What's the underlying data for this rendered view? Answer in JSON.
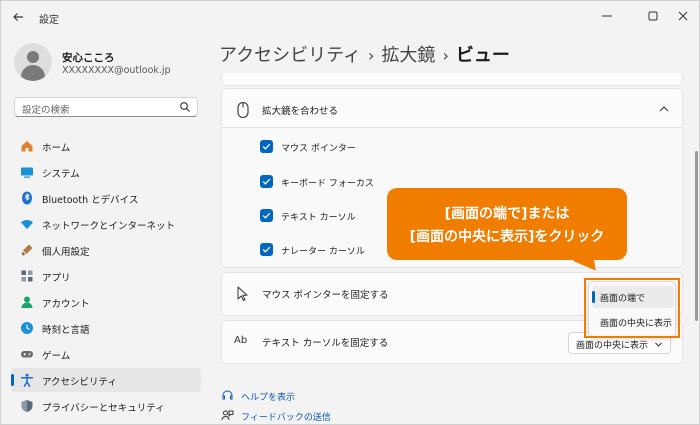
{
  "window": {
    "title": "設定",
    "controls": [
      "minimize-icon",
      "maximize-icon",
      "close-icon"
    ]
  },
  "profile": {
    "name": "安心こころ",
    "email": "XXXXXXXX@outlook.jp"
  },
  "search": {
    "placeholder": "設定の検索"
  },
  "sidebar": {
    "items": [
      {
        "label": "ホーム",
        "icon": "home-icon",
        "color": "#e0822f"
      },
      {
        "label": "システム",
        "icon": "system-icon",
        "color": "#1b8fd8"
      },
      {
        "label": "Bluetooth とデバイス",
        "icon": "bluetooth-icon",
        "color": "#1b6fd0"
      },
      {
        "label": "ネットワークとインターネット",
        "icon": "network-icon",
        "color": "#1b8fd8"
      },
      {
        "label": "個人用設定",
        "icon": "personalization-icon",
        "color": "#7a5c3a"
      },
      {
        "label": "アプリ",
        "icon": "apps-icon",
        "color": "#5a6a7a"
      },
      {
        "label": "アカウント",
        "icon": "accounts-icon",
        "color": "#1aa36b"
      },
      {
        "label": "時刻と言語",
        "icon": "time-language-icon",
        "color": "#1b8fd8"
      },
      {
        "label": "ゲーム",
        "icon": "gaming-icon",
        "color": "#6a6a6a"
      },
      {
        "label": "アクセシビリティ",
        "icon": "accessibility-icon",
        "color": "#1b6fd0",
        "active": true
      },
      {
        "label": "プライバシーとセキュリティ",
        "icon": "privacy-icon",
        "color": "#5a6a7a"
      }
    ]
  },
  "breadcrumb": {
    "parts": [
      "アクセシビリティ",
      "拡大鏡",
      "ビュー"
    ],
    "separator": "›"
  },
  "follow_section": {
    "label": "拡大鏡を合わせる",
    "icon": "mouse-icon",
    "expanded": true,
    "options": [
      {
        "label": "マウス ポインター",
        "checked": true
      },
      {
        "label": "キーボード フォーカス",
        "checked": true
      },
      {
        "label": "テキスト カーソル",
        "checked": true
      },
      {
        "label": "ナレーター カーソル",
        "checked": true
      }
    ]
  },
  "mouse_lock": {
    "label": "マウス ポインターを固定する",
    "icon": "pointer-icon",
    "menu_options": [
      "画面の端で",
      "画面の中央に表示"
    ],
    "selected": "画面の端で"
  },
  "text_lock": {
    "label": "テキスト カーソルを固定する",
    "icon": "text-cursor-icon",
    "icon_text": "Ab",
    "value": "画面の中央に表示"
  },
  "callout": {
    "line1": "[画面の端で]または",
    "line2": "[画面の中央に表示]をクリック",
    "color": "#f07c00"
  },
  "links": [
    {
      "label": "ヘルプを表示",
      "icon": "help-icon"
    },
    {
      "label": "フィードバックの送信",
      "icon": "feedback-icon"
    }
  ],
  "colors": {
    "accent": "#0067c0",
    "annotation": "#f07c00"
  }
}
